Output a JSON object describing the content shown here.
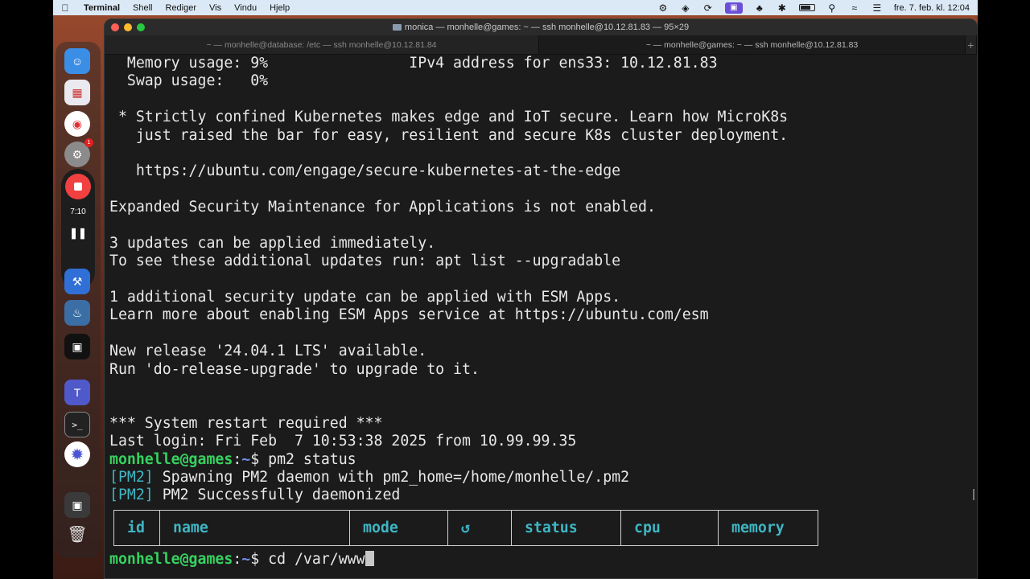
{
  "menubar": {
    "app_name": "Terminal",
    "menus": [
      "Shell",
      "Rediger",
      "Vis",
      "Vindu",
      "Hjelp"
    ],
    "clock": "fre. 7. feb. kl. 12:04"
  },
  "recorder": {
    "time": "7:10"
  },
  "dock": {
    "settings_badge": "1"
  },
  "window": {
    "title": "monica — monhelle@games: ~ — ssh monhelle@10.12.81.83 — 95×29",
    "tabs": [
      "~ — monhelle@database: /etc — ssh monhelle@10.12.81.84",
      "~ — monhelle@games: ~ — ssh monhelle@10.12.81.83"
    ],
    "new_tab": "+"
  },
  "terminal": {
    "lines": [
      "  Memory usage: 9%                IPv4 address for ens33: 10.12.81.83",
      "  Swap usage:   0%",
      "",
      " * Strictly confined Kubernetes makes edge and IoT secure. Learn how MicroK8s",
      "   just raised the bar for easy, resilient and secure K8s cluster deployment.",
      "",
      "   https://ubuntu.com/engage/secure-kubernetes-at-the-edge",
      "",
      "Expanded Security Maintenance for Applications is not enabled.",
      "",
      "3 updates can be applied immediately.",
      "To see these additional updates run: apt list --upgradable",
      "",
      "1 additional security update can be applied with ESM Apps.",
      "Learn more about enabling ESM Apps service at https://ubuntu.com/esm",
      "",
      "New release '24.04.1 LTS' available.",
      "Run 'do-release-upgrade' to upgrade to it.",
      "",
      "",
      "*** System restart required ***",
      "Last login: Fri Feb  7 10:53:38 2025 from 10.99.99.35"
    ],
    "prompt_user": "monhelle@games",
    "prompt_sep": ":",
    "prompt_path": "~",
    "prompt_symbol": "$ ",
    "cmd1": "pm2 status",
    "pm2_tag": "[PM2]",
    "pm2_msg1": " Spawning PM2 daemon with pm2_home=/home/monhelle/.pm2",
    "pm2_msg2": " PM2 Successfully daemonized",
    "table_headers": [
      "id",
      "name",
      "mode",
      "↺",
      "status",
      "cpu",
      "memory"
    ],
    "cmd2": "cd /var/www"
  }
}
